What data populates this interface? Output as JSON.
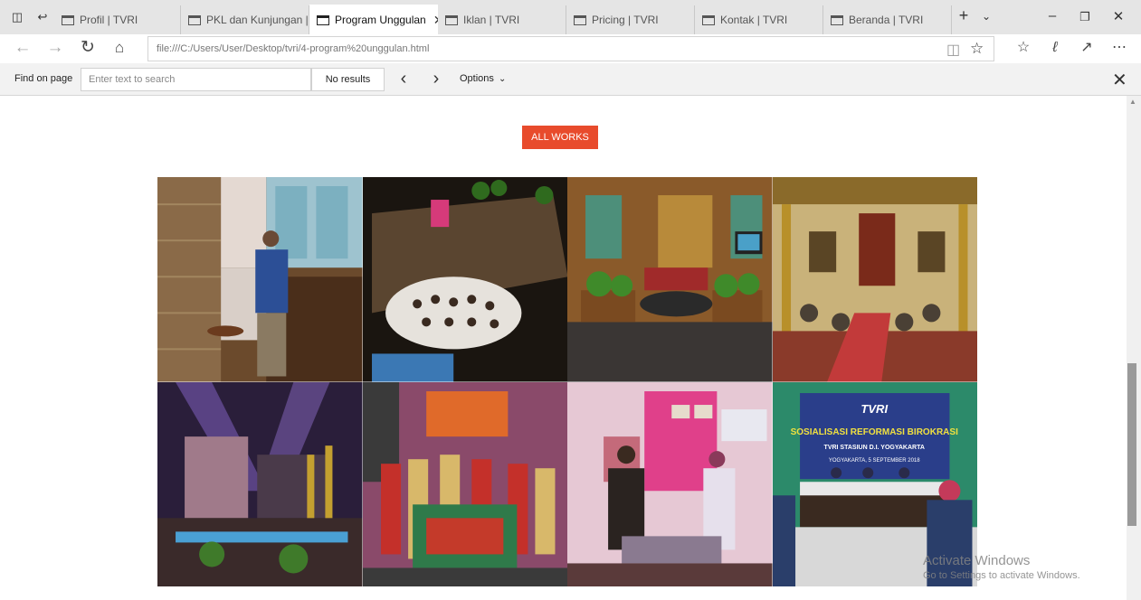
{
  "tabs": [
    {
      "label": "Profil | TVRI",
      "active": false
    },
    {
      "label": "PKL dan Kunjungan | TV",
      "active": false
    },
    {
      "label": "Program Unggulan",
      "active": true
    },
    {
      "label": "Iklan | TVRI",
      "active": false
    },
    {
      "label": "Pricing | TVRI",
      "active": false
    },
    {
      "label": "Kontak | TVRI",
      "active": false
    },
    {
      "label": "Beranda | TVRI",
      "active": false
    }
  ],
  "address": {
    "url": "file:///C:/Users/User/Desktop/tvri/4-program%20unggulan.html"
  },
  "find": {
    "label": "Find on page",
    "placeholder": "Enter text to search",
    "results": "No results",
    "options_label": "Options"
  },
  "page": {
    "all_works_label": "ALL WORKS"
  },
  "gallery_title_banner": {
    "brand": "TVRI",
    "line1": "SOSIALISASI REFORMASI BIROKRASI",
    "line2": "TVRI STASIUN D.I. YOGYAKARTA",
    "line3": "YOGYAKARTA, 5 SEPTEMBER 2018"
  },
  "watermark": {
    "title": "Activate Windows",
    "subtitle": "Go to Settings to activate Windows."
  },
  "colors": {
    "accent": "#e84b2c",
    "tabstrip": "#e5e5e5",
    "findbar": "#f2f2f2"
  }
}
